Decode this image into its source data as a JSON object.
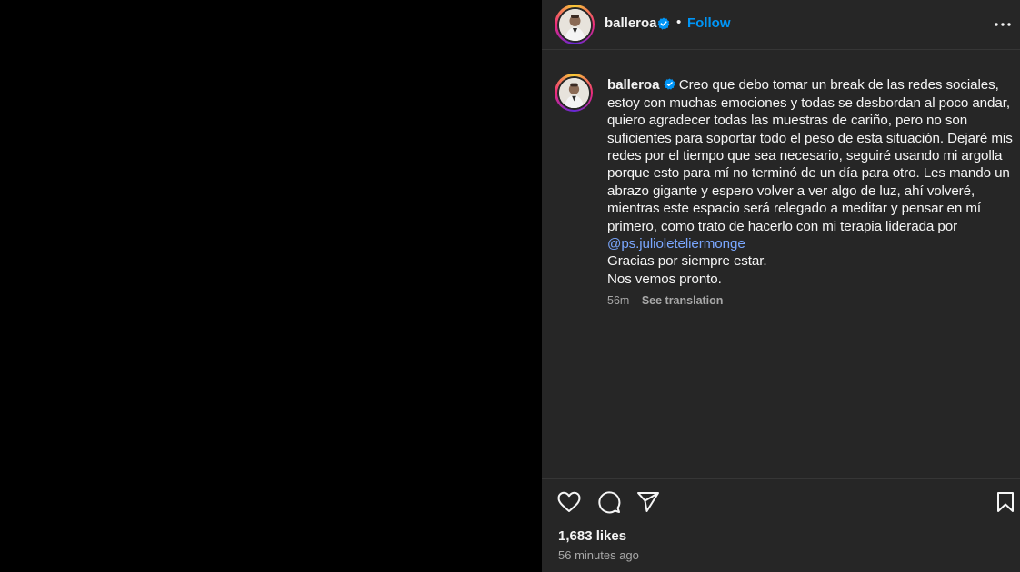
{
  "post": {
    "username": "balleroa",
    "verified": true,
    "follow_label": "Follow",
    "separator": "•"
  },
  "caption": {
    "username": "balleroa",
    "text_before_mention": "Creo que debo tomar un break de las redes sociales, estoy con muchas emociones y todas se desbordan al poco andar, quiero agradecer todas las muestras de cariño, pero no son suficientes para soportar todo el peso de esta situación. Dejaré mis redes por el tiempo que sea necesario, seguiré usando mi argolla porque esto para mí no terminó de un día para otro. Les mando un abrazo gigante y espero volver a ver algo de luz, ahí volveré, mientras este espacio será relegado a meditar y pensar en mí primero, como trato de hacerlo con mi terapia liderada por",
    "mention": "@ps.julioleteliermonge",
    "line_after_1": "Gracias por siempre estar.",
    "line_after_2": "Nos vemos pronto.",
    "timestamp": "56m",
    "translate_label": "See translation"
  },
  "actions": {
    "icons": [
      "heart-icon",
      "comment-icon",
      "share-icon",
      "bookmark-icon"
    ]
  },
  "stats": {
    "likes": "1,683 likes",
    "posted_ago": "56 minutes ago"
  },
  "colors": {
    "panel_bg": "#262626",
    "media_bg": "#000000",
    "link_blue": "#0095f6",
    "mention_blue": "#7aa7ff",
    "secondary_text": "#a8a8a8"
  }
}
